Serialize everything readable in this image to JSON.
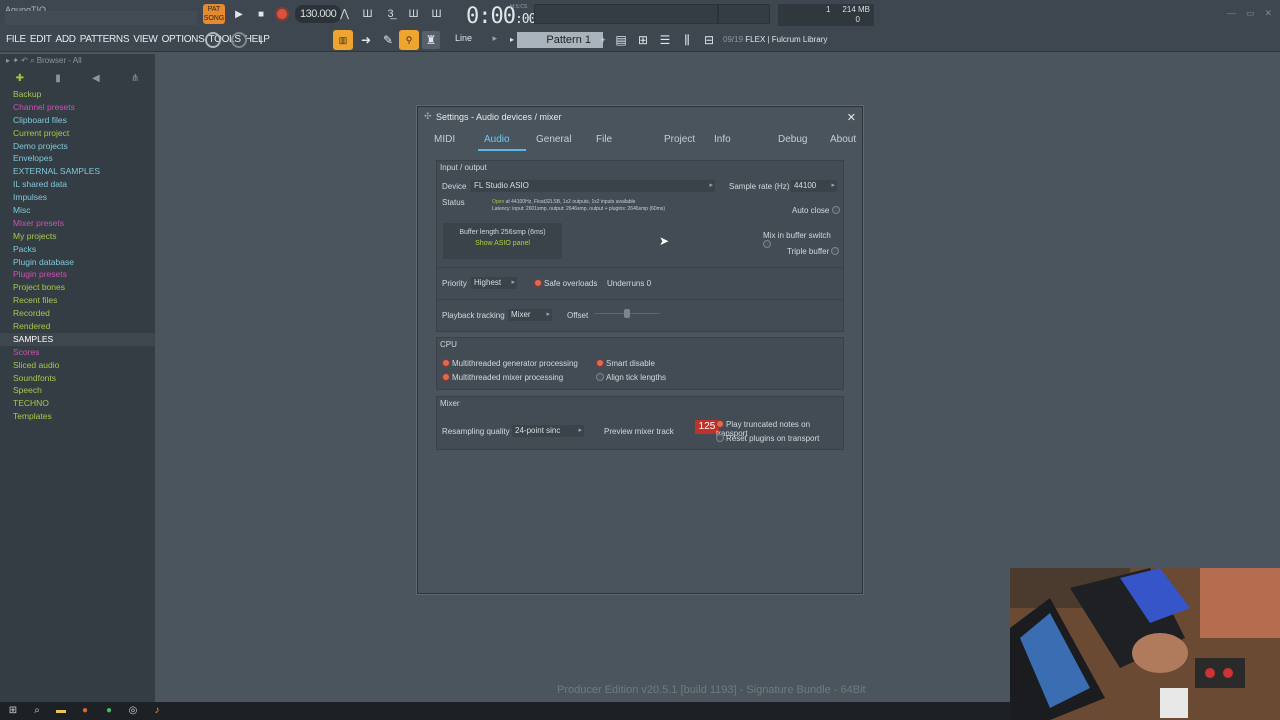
{
  "app": {
    "project_title": "AgungTIO",
    "pat_label": "PAT",
    "song_label": "SONG",
    "tempo": "130.000",
    "time_main": "0:00",
    "time_small": ":00",
    "msc_label": "M:S:CS",
    "cpu_value": "1",
    "memory": "214 MB",
    "polyphony": "0"
  },
  "menu": [
    "FILE",
    "EDIT",
    "ADD",
    "PATTERNS",
    "VIEW",
    "OPTIONS",
    "TOOLS",
    "HELP"
  ],
  "toolbar": {
    "snap": "Line",
    "pattern": "Pattern 1",
    "hint_counter": "09/19",
    "hint_text": "FLEX | Fulcrum Library"
  },
  "browser": {
    "header": "Browser - All",
    "items": [
      "Backup",
      "Channel presets",
      "Clipboard files",
      "Current project",
      "Demo projects",
      "Envelopes",
      "EXTERNAL SAMPLES",
      "IL shared data",
      "Impulses",
      "Misc",
      "Mixer presets",
      "My projects",
      "Packs",
      "Plugin database",
      "Plugin presets",
      "Project bones",
      "Recent files",
      "Recorded",
      "Rendered",
      "SAMPLES",
      "Scores",
      "Sliced audio",
      "Soundfonts",
      "Speech",
      "TECHNO",
      "Templates"
    ],
    "item_colors": [
      "#a6c84a",
      "#d04fb5",
      "#7fc9dc",
      "#a6c84a",
      "#7fc9dc",
      "#7fc9dc",
      "#7fc9dc",
      "#7fc9dc",
      "#7fc9dc",
      "#7fc9dc",
      "#d04fb5",
      "#a6c84a",
      "#7fc9dc",
      "#7fc9dc",
      "#d04fb5",
      "#a6c84a",
      "#a6c84a",
      "#a6c84a",
      "#a6c84a",
      "#ffffff",
      "#d04fb5",
      "#a6c84a",
      "#a6c84a",
      "#a6c84a",
      "#a6c84a",
      "#a6c84a"
    ]
  },
  "dialog": {
    "title": "Settings - Audio devices / mixer",
    "tabs": [
      "MIDI",
      "Audio",
      "General",
      "File",
      "Project",
      "Info",
      "Debug",
      "About"
    ],
    "io": {
      "section_title": "Input / output",
      "device_label": "Device",
      "device_value": "FL Studio ASIO",
      "sample_rate_label": "Sample rate (Hz)",
      "sample_rate_value": "44100",
      "status_label": "Status",
      "status_open": "Open",
      "status_line1": "at 44100Hz, Float32LSB, 1x2 outputs, 1x2 inputs available",
      "status_line2": "Latency: input: 2601smp, output: 2646smp, output + plugins: 2646smp (60ms)",
      "auto_close": "Auto close",
      "buffer_length": "Buffer length 256smp (6ms)",
      "show_asio": "Show ASIO panel",
      "mix_in_buffer": "Mix in buffer switch",
      "triple_buffer": "Triple buffer",
      "priority_label": "Priority",
      "priority_value": "Highest",
      "safe_overloads": "Safe overloads",
      "underruns": "Underruns 0",
      "playback_tracking_label": "Playback tracking",
      "playback_tracking_value": "Mixer",
      "offset_label": "Offset"
    },
    "cpu": {
      "section_title": "CPU",
      "multi_gen": "Multithreaded generator processing",
      "multi_mixer": "Multithreaded mixer processing",
      "smart_disable": "Smart disable",
      "align_tick": "Align tick lengths"
    },
    "mixer": {
      "section_title": "Mixer",
      "resampling_label": "Resampling quality",
      "resampling_value": "24-point sinc",
      "preview_label": "Preview mixer track",
      "preview_value": "125",
      "play_truncated": "Play truncated notes on transport",
      "reset_plugins": "Reset plugins on transport"
    }
  },
  "footer": {
    "version": "Producer Edition v20.5.1 [build 1193] - Signature Bundle - 64Bit"
  },
  "colors": {
    "accent": "#5bb8e5",
    "orange": "#f0a430",
    "green": "#a4c642",
    "red": "#c0312a"
  }
}
